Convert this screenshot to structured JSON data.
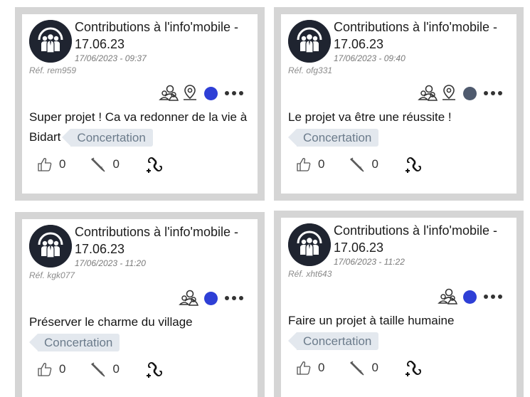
{
  "colors": {
    "border": "#d5d5d5",
    "dot_blue": "#2e3fd6",
    "dot_gray": "#4f5a6e",
    "tag_bg": "#e3e8ee"
  },
  "cards": [
    {
      "title": "Contributions à l'info'mobile - 17.06.23",
      "date": "17/06/2023 - 09:37",
      "ref": "Réf. rem959",
      "text": "Super projet ! Ca va redonner de la vie à Bidart",
      "tag": "Concertation",
      "likes": "0",
      "edits": "0",
      "status": "blue",
      "icons": [
        "group-icon",
        "map-pin-icon"
      ]
    },
    {
      "title": "Contributions à l'info'mobile - 17.06.23",
      "date": "17/06/2023 - 09:40",
      "ref": "Réf. ofg331",
      "text": "Le projet va être une réussite !",
      "tag": "Concertation",
      "likes": "0",
      "edits": "0",
      "status": "gray",
      "icons": [
        "group-icon",
        "map-pin-icon"
      ]
    },
    {
      "title": "Contributions à l'info'mobile - 17.06.23",
      "date": "17/06/2023 - 11:20",
      "ref": "Réf. kgk077",
      "text": "Préserver le charme du village",
      "tag": "Concertation",
      "likes": "0",
      "edits": "0",
      "status": "blue",
      "icons": [
        "group-icon"
      ]
    },
    {
      "title": "Contributions à l'info'mobile - 17.06.23",
      "date": "17/06/2023 - 11:22",
      "ref": "Réf. xht643",
      "text": "Faire un projet à taille humaine",
      "tag": "Concertation",
      "likes": "0",
      "edits": "0",
      "status": "blue",
      "icons": [
        "group-icon"
      ]
    }
  ]
}
